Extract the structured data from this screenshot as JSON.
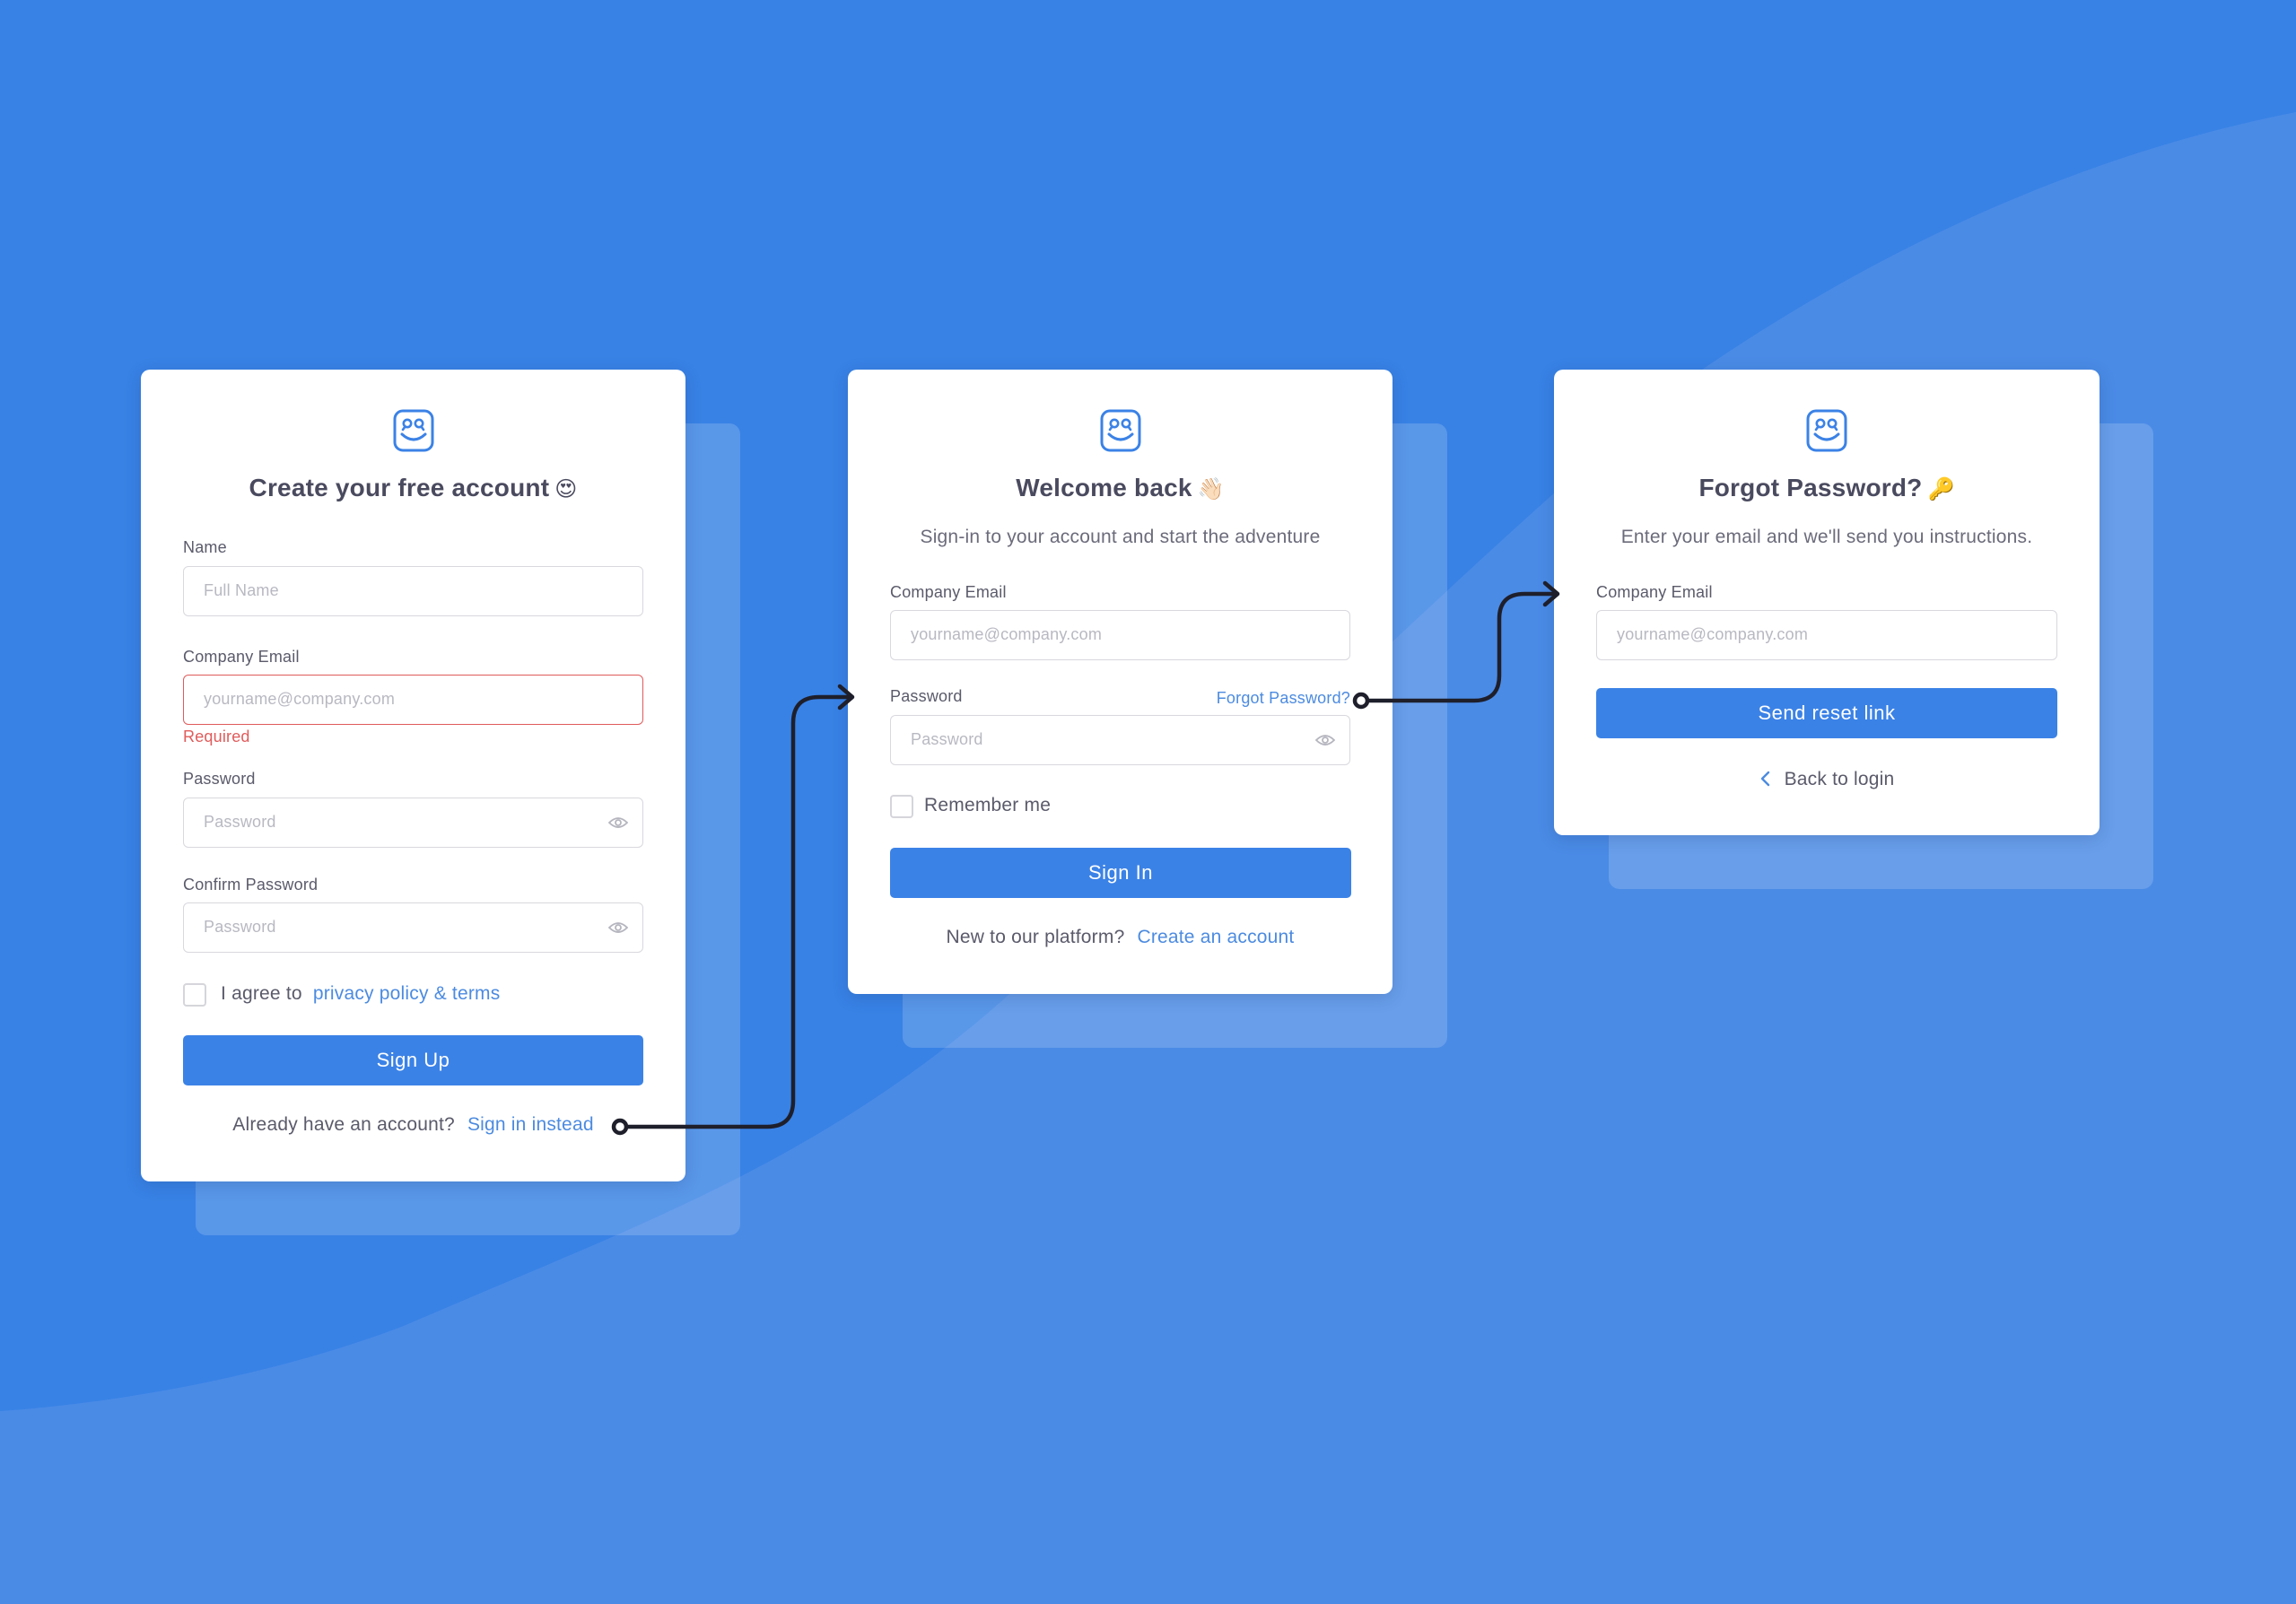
{
  "colors": {
    "background": "#3882E5",
    "accent": "#3B82E6",
    "link": "#4C8BE0",
    "error": "#E05B5B",
    "card": "#FFFFFF"
  },
  "signup_card": {
    "logo_icon": "smiley-logo-icon",
    "title": "Create your free account",
    "title_emoji": "😍",
    "name": {
      "label": "Name",
      "placeholder": "Full Name",
      "value": ""
    },
    "email": {
      "label": "Company Email",
      "placeholder": "yourname@company.com",
      "value": "",
      "error": "Required"
    },
    "password": {
      "label": "Password",
      "placeholder": "Password",
      "value": "",
      "icon": "eye-icon"
    },
    "confirm_password": {
      "label": "Confirm Password",
      "placeholder": "Password",
      "value": "",
      "icon": "eye-icon"
    },
    "agree": {
      "checked": false,
      "text": "I agree to",
      "link": "privacy policy & terms"
    },
    "submit_label": "Sign Up",
    "footer": {
      "text": "Already have an account?",
      "link": "Sign in instead"
    }
  },
  "signin_card": {
    "logo_icon": "smiley-logo-icon",
    "title": "Welcome back",
    "title_emoji": "👋🏻",
    "subtitle": "Sign-in to your account and start the adventure",
    "email": {
      "label": "Company Email",
      "placeholder": "yourname@company.com",
      "value": ""
    },
    "password": {
      "label": "Password",
      "placeholder": "Password",
      "value": "",
      "icon": "eye-icon",
      "forgot_link": "Forgot Password?"
    },
    "remember": {
      "checked": false,
      "label": "Remember me"
    },
    "submit_label": "Sign In",
    "footer": {
      "text": "New to our platform?",
      "link": "Create an account"
    }
  },
  "forgot_card": {
    "logo_icon": "smiley-logo-icon",
    "title": "Forgot Password?",
    "title_emoji": "🔑",
    "subtitle": "Enter your email and we'll send you instructions.",
    "email": {
      "label": "Company Email",
      "placeholder": "yourname@company.com",
      "value": ""
    },
    "submit_label": "Send reset link",
    "back_link": "Back to login",
    "back_icon": "chevron-left-icon"
  },
  "flow_connectors": [
    {
      "from": "Sign in instead",
      "to": "signin_card"
    },
    {
      "from": "Forgot Password?",
      "to": "forgot_card"
    }
  ]
}
